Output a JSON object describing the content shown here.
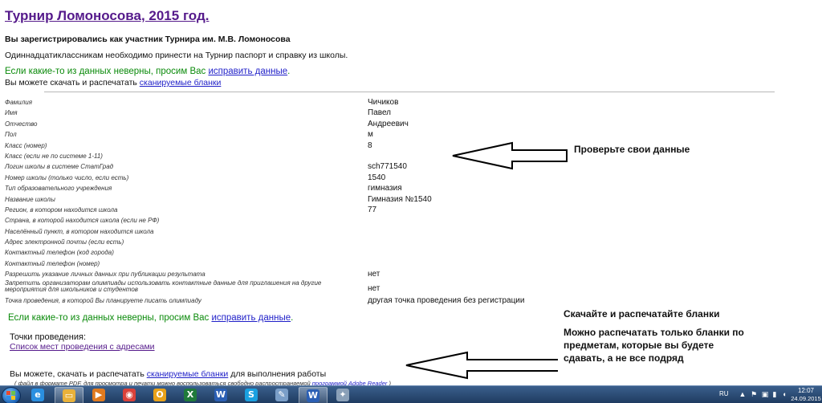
{
  "page": {
    "title": "Турнир Ломоносова, 2015 год.",
    "registered_text": "Вы зарегистрировались как участник Турнира им. М.В. Ломоносова",
    "passport_text": "Одиннадцатиклассникам необходимо принести на Турнир паспорт и справку из школы.",
    "fix_prefix": "Если какие-то из данных неверны, просим Вас ",
    "fix_link": "исправить данные",
    "fix_suffix": ".",
    "download_prefix": "Вы можете скачать и распечатать ",
    "download_link": "сканируемые бланки"
  },
  "fields": [
    {
      "label": "Фамилия",
      "value": "Чичиков"
    },
    {
      "label": "Имя",
      "value": "Павел"
    },
    {
      "label": "Отчество",
      "value": "Андреевич"
    },
    {
      "label": "Пол",
      "value": "м"
    },
    {
      "label": "Класс (номер)",
      "value": "8"
    },
    {
      "label": "Класс (если не по системе 1-11)",
      "value": ""
    },
    {
      "label": "Логин школы в системе СтатГрад",
      "value": "sch771540"
    },
    {
      "label": "Номер школы (только число, если есть)",
      "value": "1540"
    },
    {
      "label": "Тип образовательного учреждения",
      "value": "гимназия"
    },
    {
      "label": "Название школы",
      "value": "Гимназия №1540"
    },
    {
      "label": "Регион, в котором находится школа",
      "value": "77"
    },
    {
      "label": "Страна, в которой находится школа (если не РФ)",
      "value": ""
    },
    {
      "label": "Населённый пункт, в котором находится школа",
      "value": ""
    },
    {
      "label": "Адрес электронной почты (если есть)",
      "value": ""
    },
    {
      "label": "Контактный телефон (код города)",
      "value": ""
    },
    {
      "label": "Контактный телефон (номер)",
      "value": ""
    },
    {
      "label": "Разрешить указание личных данных при публикации результата",
      "value": "нет"
    },
    {
      "label": "Запретить организаторам олимпиады использовать контактные данные для приглашения на другие мероприятия для школьников и студентов",
      "value": "нет",
      "tall": true
    },
    {
      "label": "Точка проведения, в которой Вы планируете писать олимпиаду",
      "value": "другая точка проведения без регистрации"
    }
  ],
  "bottom": {
    "points_label": "Точки проведения:",
    "points_link": "Список мест проведения с адресами",
    "download_prefix": "Вы можете, скачать и распечатать ",
    "download_link": "сканируемые бланки",
    "download_suffix": " для выполнения работы",
    "pdf_note_prefix": "( файл в формате PDF, для просмотра и печати можно воспользоваться свободно распространяемой ",
    "pdf_note_link": "программой Adobe Reader",
    "pdf_note_suffix": " )"
  },
  "annotations": {
    "check_data": "Проверьте свои данные",
    "download_print": "Скачайте и распечатайте бланки",
    "note": "Можно распечатать только бланки по предметам, которые вы будете сдавать, а не все подряд"
  },
  "taskbar": {
    "apps": [
      {
        "icon": "internet-explorer-icon",
        "glyph": "e",
        "color": "#2a8fe0"
      },
      {
        "icon": "windows-explorer-icon",
        "glyph": "▭",
        "color": "#e8b13a"
      },
      {
        "icon": "media-player-icon",
        "glyph": "▶",
        "color": "#e07a1f"
      },
      {
        "icon": "chrome-icon",
        "glyph": "◉",
        "color": "#d9413a"
      },
      {
        "icon": "outlook-icon",
        "glyph": "O",
        "color": "#e8a21a"
      },
      {
        "icon": "excel-icon",
        "glyph": "X",
        "color": "#1f7a3a"
      },
      {
        "icon": "word-icon",
        "glyph": "W",
        "color": "#2b5fb4"
      },
      {
        "icon": "skype-icon",
        "glyph": "S",
        "color": "#1aa0e0"
      },
      {
        "icon": "paint-icon",
        "glyph": "✎",
        "color": "#7a9ec8"
      },
      {
        "icon": "word-document-icon",
        "glyph": "W",
        "color": "#2b5fb4"
      },
      {
        "icon": "file-icon",
        "glyph": "✦",
        "color": "#8aa0b8"
      }
    ],
    "language": "RU",
    "time": "12:07",
    "date": "24.09.2015"
  }
}
